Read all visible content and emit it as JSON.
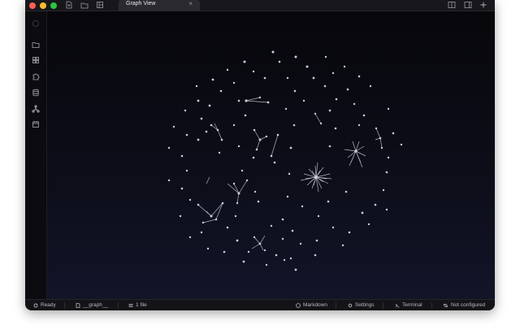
{
  "tab": {
    "title": "Graph View",
    "close": "×"
  },
  "status": {
    "ready": "Ready",
    "graph": "__graph__",
    "files": "1 file",
    "markdown": "Markdown",
    "settings": "Settings",
    "terminal": "Terminal",
    "sync": "Not configured"
  },
  "colors": {
    "accent_node": "#c9ccd8",
    "edge": "#b4b7c4",
    "background": "#0b0b12"
  }
}
